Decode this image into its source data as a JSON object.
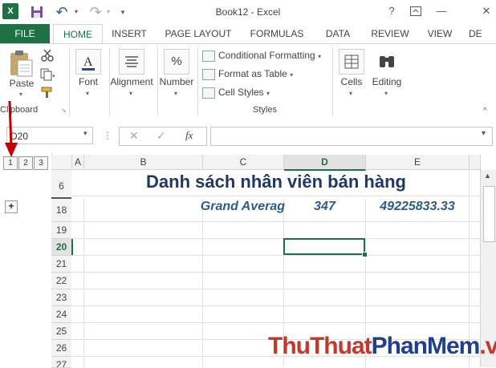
{
  "window": {
    "title": "Book12 - Excel",
    "help": "?",
    "minimize": "—",
    "close": "✕"
  },
  "qat": {
    "save": "💾",
    "undo": "↶",
    "redo": "↷"
  },
  "tabs": [
    {
      "label": "FILE"
    },
    {
      "label": "HOME"
    },
    {
      "label": "INSERT"
    },
    {
      "label": "PAGE LAYOUT"
    },
    {
      "label": "FORMULAS"
    },
    {
      "label": "DATA"
    },
    {
      "label": "REVIEW"
    },
    {
      "label": "VIEW"
    },
    {
      "label": "DE"
    }
  ],
  "ribbon": {
    "paste": "Paste",
    "clipboard": "Clipboard",
    "font": "Font",
    "alignment": "Alignment",
    "number": "Number",
    "number_icon": "%",
    "conditional_formatting": "Conditional Formatting",
    "format_as_table": "Format as Table",
    "cell_styles": "Cell Styles",
    "styles": "Styles",
    "cells": "Cells",
    "editing": "Editing"
  },
  "formula_bar": {
    "name_box": "D20",
    "fx": "fx",
    "cancel": "✕",
    "enter": "✓",
    "formula": ""
  },
  "outline": {
    "levels": [
      "1",
      "2",
      "3"
    ],
    "expand": "+"
  },
  "columns": [
    "A",
    "B",
    "C",
    "D",
    "E"
  ],
  "rows": [
    "6",
    "18",
    "19",
    "20",
    "21",
    "22",
    "23",
    "24",
    "25",
    "26",
    "27"
  ],
  "cells": {
    "title": "Danh sách nhân viên bán hàng",
    "grand_average_label": "Grand Averag",
    "grand_average_d": "347",
    "grand_average_e": "49225833.33"
  },
  "watermark": {
    "part1": "ThuThuat",
    "part2": "PhanMem",
    "part3": ".vn"
  },
  "colors": {
    "excel_green": "#1e7145",
    "title_blue": "#1f3864",
    "value_blue": "#2e5c8a",
    "arrow_red": "#c00000"
  }
}
